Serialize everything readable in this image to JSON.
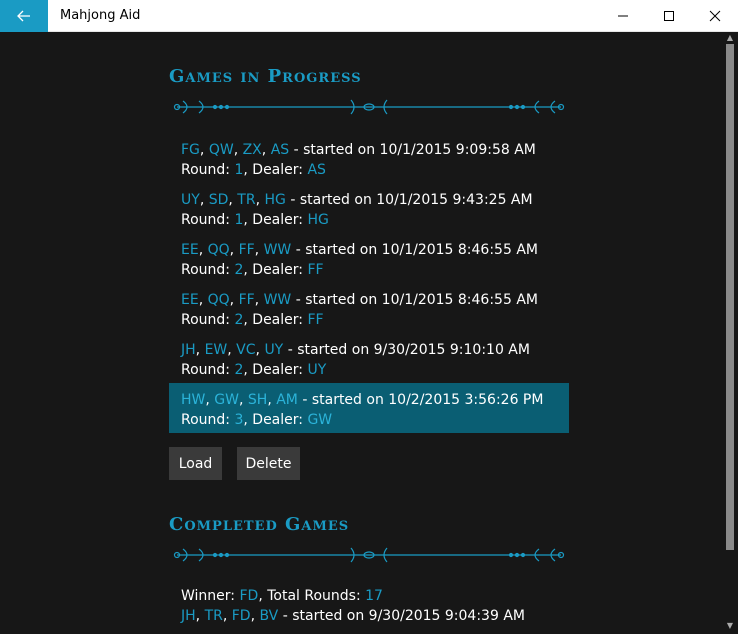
{
  "window": {
    "title": "Mahjong Aid"
  },
  "sections": {
    "in_progress_title": "Games in Progress",
    "completed_title": "Completed Games"
  },
  "games": [
    {
      "players": [
        "FG",
        "QW",
        "ZX",
        "AS"
      ],
      "started": " - started on 10/1/2015 9:09:58 AM",
      "round_label": "Round: ",
      "round": "1",
      "dealer_label": ", Dealer: ",
      "dealer": "AS"
    },
    {
      "players": [
        "UY",
        "SD",
        "TR",
        "HG"
      ],
      "started": " - started on 10/1/2015 9:43:25 AM",
      "round_label": "Round: ",
      "round": "1",
      "dealer_label": ", Dealer: ",
      "dealer": "HG"
    },
    {
      "players": [
        "EE",
        "QQ",
        "FF",
        "WW"
      ],
      "started": " - started on 10/1/2015 8:46:55 AM",
      "round_label": "Round: ",
      "round": "2",
      "dealer_label": ", Dealer: ",
      "dealer": "FF"
    },
    {
      "players": [
        "EE",
        "QQ",
        "FF",
        "WW"
      ],
      "started": " - started on 10/1/2015 8:46:55 AM",
      "round_label": "Round: ",
      "round": "2",
      "dealer_label": ", Dealer: ",
      "dealer": "FF"
    },
    {
      "players": [
        "JH",
        "EW",
        "VC",
        "UY"
      ],
      "started": " - started on 9/30/2015 9:10:10 AM",
      "round_label": "Round: ",
      "round": "2",
      "dealer_label": ", Dealer: ",
      "dealer": "UY"
    },
    {
      "players": [
        "HW",
        "GW",
        "SH",
        "AM"
      ],
      "started": " - started on 10/2/2015 3:56:26 PM",
      "round_label": "Round: ",
      "round": "3",
      "dealer_label": ", Dealer: ",
      "dealer": "GW",
      "selected": true
    }
  ],
  "buttons": {
    "load": "Load",
    "delete": "Delete"
  },
  "completed": [
    {
      "winner_label": "Winner: ",
      "winner": "FD",
      "rounds_label": ", Total Rounds: ",
      "rounds": "17",
      "players": [
        "JH",
        "TR",
        "FD",
        "BV"
      ],
      "started": " - started on 9/30/2015 9:04:39 AM"
    }
  ],
  "colors": {
    "accent": "#1a9bc4",
    "selected": "#0a5e73",
    "background": "#171717",
    "button": "#3a3a3a"
  }
}
